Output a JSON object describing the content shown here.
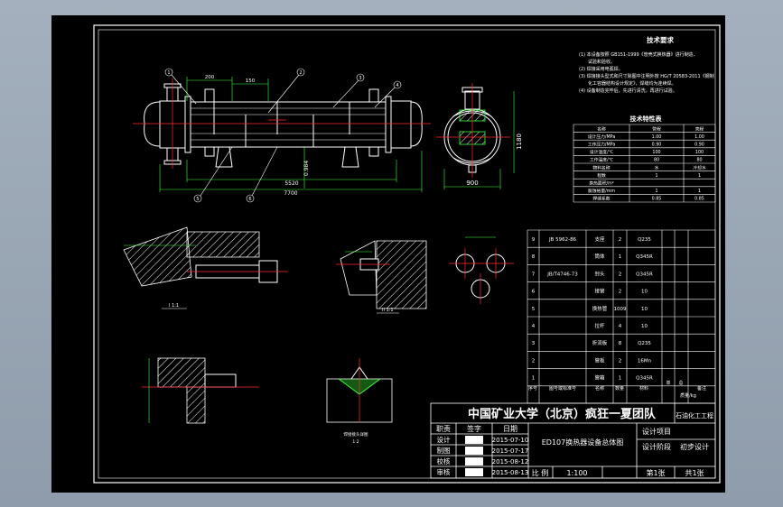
{
  "tech_requirements": {
    "title": "技术要求",
    "items": [
      "(1) 本设备按照 GB151-1999《管壳式换热器》进行制造、",
      "试验和验收。",
      "(2) 焊接采用电弧焊。",
      "(3) 焊接接头型式和尺寸除图中注明外按 HG/T 20583-2011《钢制",
      "化工容器结构设计规定》，焊缝均为连续焊。",
      "(4) 设备制造完毕后，先进行清洗，再进行试验。"
    ]
  },
  "tech_specs": {
    "title": "技术特性表",
    "header": [
      "名称",
      "管程",
      "壳程"
    ],
    "rows": [
      [
        "设计压力/MPa",
        "1.00",
        "1.00"
      ],
      [
        "工作压力/MPa",
        "0.90",
        "0.90"
      ],
      [
        "设计温度/℃",
        "100",
        "100"
      ],
      [
        "工作温度/℃",
        "80",
        "80"
      ],
      [
        "物料名称",
        "水",
        "冷却水"
      ],
      [
        "程数",
        "1",
        "1"
      ],
      [
        "换热面积/m²",
        "",
        ""
      ],
      [
        "腐蚀裕量/mm",
        "1",
        "1"
      ],
      [
        "焊缝系数",
        "0.85",
        "0.85"
      ]
    ]
  },
  "parts_list": {
    "rows": [
      {
        "no": "9",
        "code": "JB 5962-86",
        "name": "支座",
        "qty": "2",
        "material": "Q235"
      },
      {
        "no": "8",
        "code": "",
        "name": "筒体",
        "qty": "1",
        "material": "Q345R"
      },
      {
        "no": "7",
        "code": "JB/T4746-73",
        "name": "封头",
        "qty": "2",
        "material": "Q345R"
      },
      {
        "no": "6",
        "code": "",
        "name": "接管",
        "qty": "2",
        "material": "10"
      },
      {
        "no": "5",
        "code": "",
        "name": "换热管",
        "qty": "1009",
        "material": "10"
      },
      {
        "no": "4",
        "code": "",
        "name": "拉杆",
        "qty": "4",
        "material": "10"
      },
      {
        "no": "3",
        "code": "",
        "name": "折流板",
        "qty": "8",
        "material": "Q235"
      },
      {
        "no": "2",
        "code": "",
        "name": "管板",
        "qty": "2",
        "material": "16Mn"
      },
      {
        "no": "1",
        "code": "",
        "name": "管箱",
        "qty": "1",
        "material": "Q345R"
      }
    ],
    "header": [
      "序号",
      "图号或标准号",
      "名称",
      "数量",
      "材料",
      "单",
      "总",
      "质量/kg",
      "备注"
    ]
  },
  "title_block": {
    "org": "中国矿业大学（北京）疯狂一夏团队",
    "right_top": "石油化工工程",
    "left_header": [
      "职责",
      "签字",
      "日期"
    ],
    "rows": [
      {
        "role": "设计",
        "date": "2015-07-10"
      },
      {
        "role": "制图",
        "date": "2015-07-17"
      },
      {
        "role": "校核",
        "date": "2015-08-12"
      },
      {
        "role": "审核",
        "date": "2015-08-13"
      }
    ],
    "drawing_title": "ED107换热器设备总体图",
    "design_project_label": "设计项目",
    "design_stage_label": "设计阶段",
    "design_stage_value": "初步设计",
    "scale_label": "比 例",
    "scale_value": "1:100",
    "sheet_label": "第1张",
    "total_label": "共1张"
  },
  "main_view": {
    "dims": {
      "total_length": "7700",
      "support_span": "5520",
      "nozzle_a": "200",
      "nozzle_b": "150",
      "height_tag": "0.984"
    },
    "balloons": [
      "1",
      "2",
      "3",
      "4",
      "5",
      "6"
    ]
  },
  "side_view": {
    "width_dim": "900",
    "height_dim": "1180"
  },
  "details": {
    "detail_I_label": "I 1:1",
    "detail_II_label": "II 1:1",
    "weld_label": "焊接接头详图",
    "weld_sub": "1:2"
  },
  "colors": {
    "line": "#ffffff",
    "center": "#ff2d2d",
    "dim": "#3cff3c",
    "hatch": "#ffffff",
    "accent": "#ffff40"
  }
}
